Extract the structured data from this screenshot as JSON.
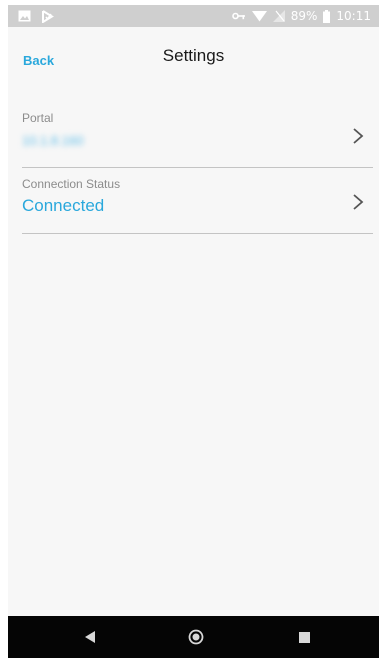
{
  "status_bar": {
    "battery_percent": "89%",
    "time": "10:11",
    "left_icons": [
      "image-icon",
      "voicemail-check-icon"
    ],
    "right_icons": [
      "vpn-key-icon",
      "wifi-icon",
      "cell-signal-icon",
      "battery-icon"
    ]
  },
  "header": {
    "back_label": "Back",
    "title": "Settings"
  },
  "settings": {
    "items": [
      {
        "label": "Portal",
        "value": "10.1.8.160",
        "value_obscured": true,
        "chevron": "chevron-right-icon"
      },
      {
        "label": "Connection Status",
        "value": "Connected",
        "value_obscured": false,
        "chevron": "chevron-right-icon"
      }
    ]
  },
  "nav_bar": {
    "buttons": [
      "back-triangle-icon",
      "home-circle-icon",
      "recents-square-icon"
    ]
  },
  "colors": {
    "accent": "#2aa8dc",
    "label_gray": "#8c8c8c",
    "background": "#f7f7f7",
    "status_bar": "#cfcfcf",
    "nav_bar": "#050505"
  }
}
